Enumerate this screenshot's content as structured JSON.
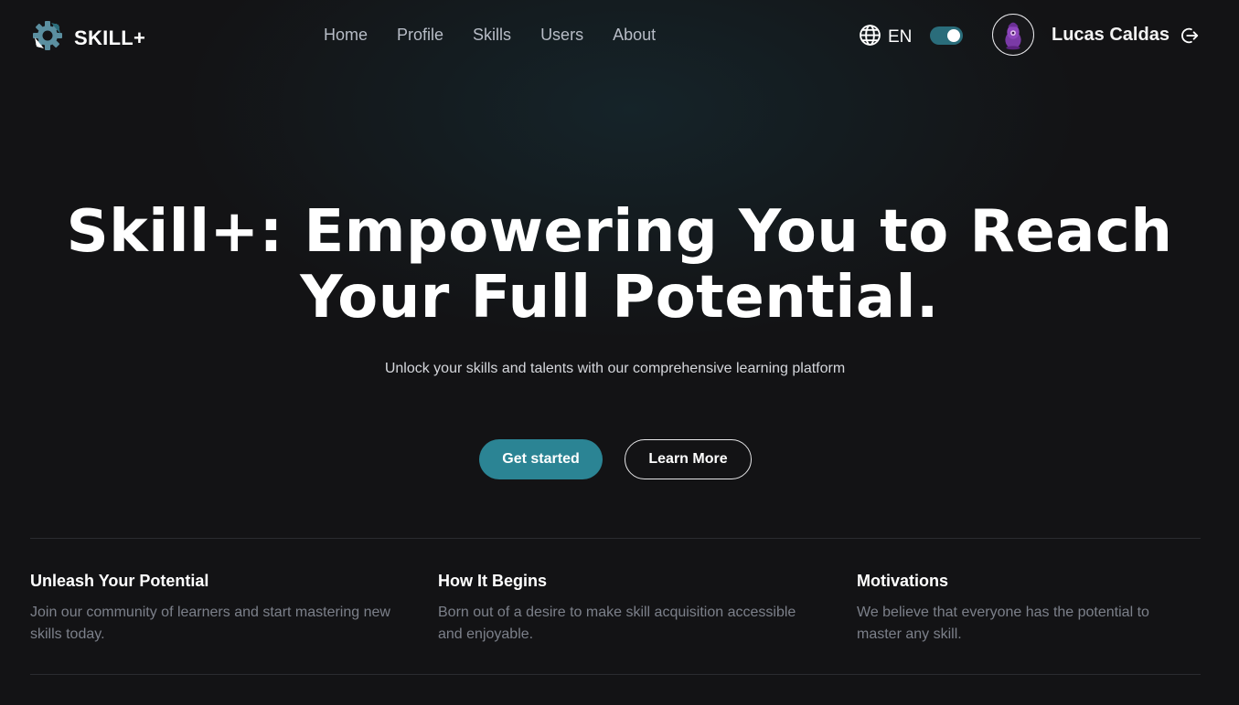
{
  "brand": {
    "name": "SKILL+",
    "icon": "gear-logo-icon"
  },
  "nav": {
    "links": [
      {
        "label": "Home"
      },
      {
        "label": "Profile"
      },
      {
        "label": "Skills"
      },
      {
        "label": "Users"
      },
      {
        "label": "About"
      }
    ]
  },
  "language": {
    "icon": "globe-icon",
    "label": "EN"
  },
  "theme_toggle": {
    "checked": true,
    "color": "#2a6d7b"
  },
  "user": {
    "name": "Lucas Caldas",
    "avatar_icon": "purple-character-avatar",
    "logout_icon": "logout-icon"
  },
  "hero": {
    "title": "Skill+: Empowering You to Reach Your Full Potential.",
    "subtitle": "Unlock your skills and talents with our comprehensive learning platform",
    "primary_button": "Get started",
    "secondary_button": "Learn More"
  },
  "features": [
    {
      "title": "Unleash Your Potential",
      "text": "Join our community of learners and start mastering new skills today."
    },
    {
      "title": "How It Begins",
      "text": "Born out of a desire to make skill acquisition accessible and enjoyable."
    },
    {
      "title": "Motivations",
      "text": "We believe that everyone has the potential to master any skill."
    }
  ],
  "colors": {
    "accent": "#2b8494",
    "background": "#131315",
    "muted_text": "#7c808a"
  }
}
